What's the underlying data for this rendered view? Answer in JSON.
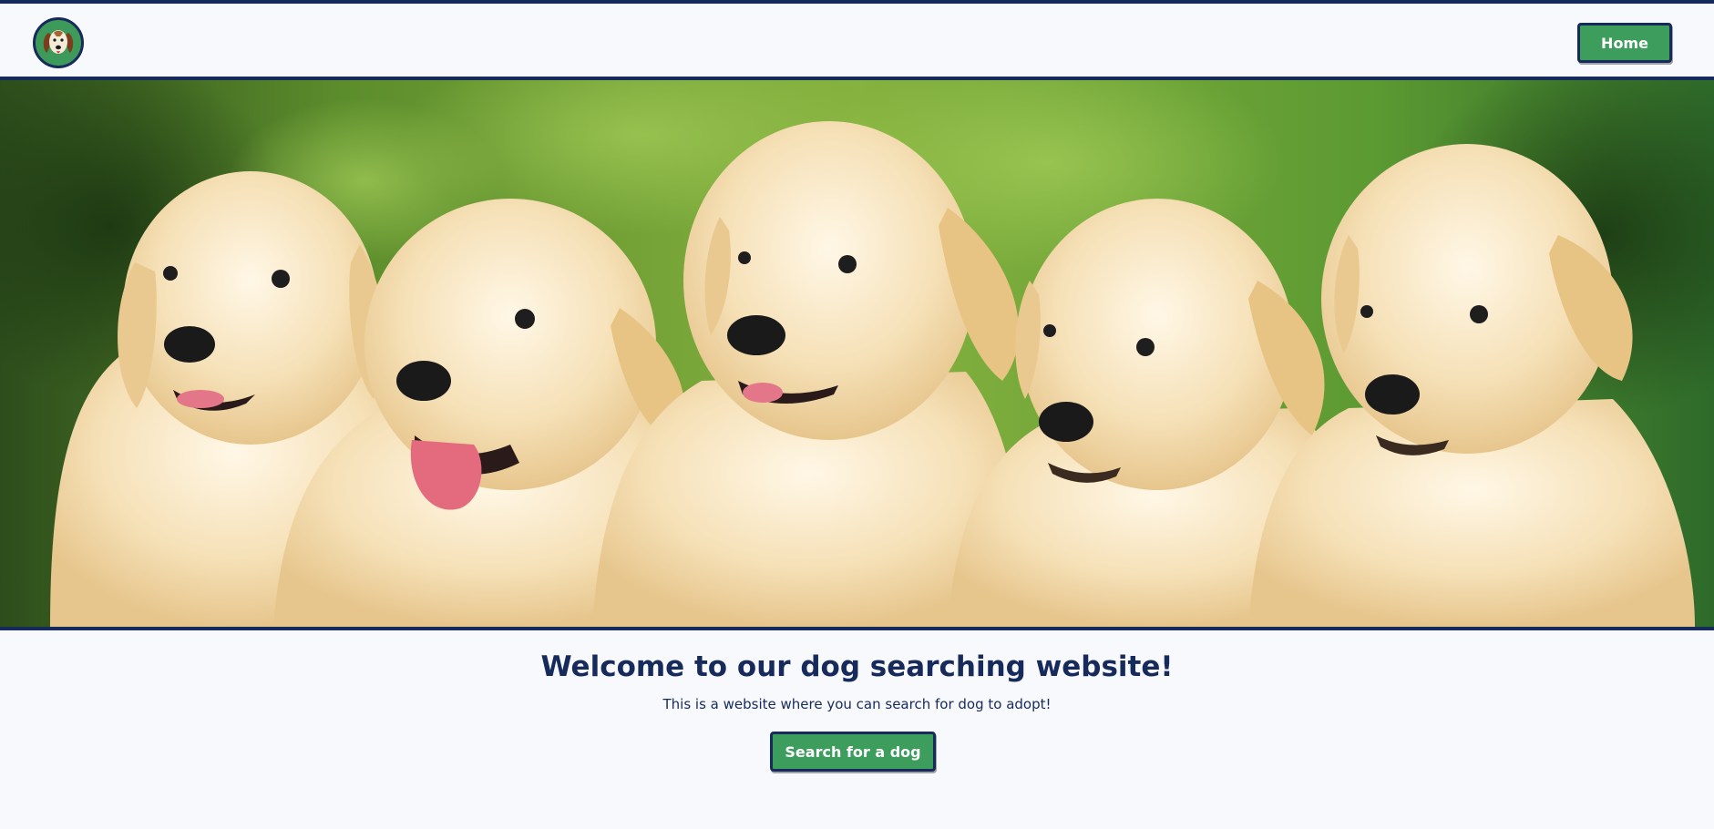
{
  "header": {
    "logo_icon": "dog-face-icon",
    "home_label": "Home"
  },
  "hero": {
    "image_subject": "five golden retriever puppies on green foliage background"
  },
  "main": {
    "title": "Welcome to our dog searching website!",
    "subtitle": "This is a website where you can search for dog to adopt!",
    "search_button_label": "Search for a dog"
  },
  "colors": {
    "navy": "#172a5c",
    "green": "#3c9d5c",
    "background": "#f8f9fc"
  }
}
